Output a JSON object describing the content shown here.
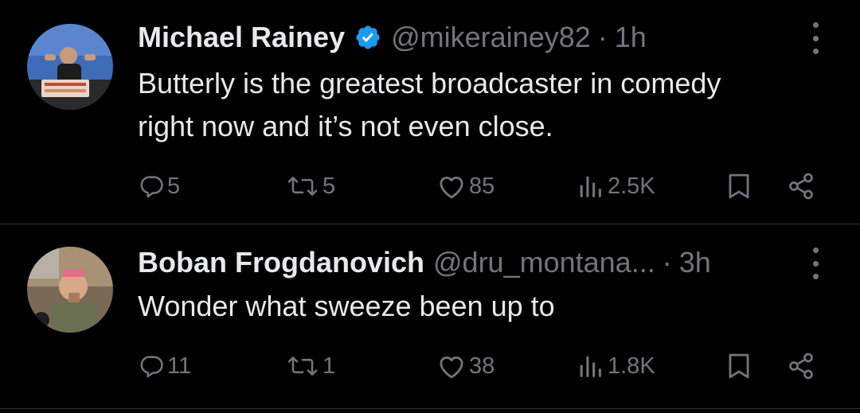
{
  "tweets": [
    {
      "name": "Michael Rainey",
      "verified": true,
      "handle": "@mikerainey82",
      "dot": "·",
      "time": "1h",
      "text_lines": [
        "Butterly is the greatest broadcaster in comedy",
        "right now and it’s not even close."
      ],
      "replies": "5",
      "reposts": "5",
      "likes": "85",
      "views": "2.5K",
      "avatar_icon": "avatar-photo"
    },
    {
      "name": "Boban Frogdanovich",
      "verified": false,
      "handle": "@dru_montana...",
      "dot": "·",
      "time": "3h",
      "text_lines": [
        "Wonder what sweeze been up to"
      ],
      "replies": "11",
      "reposts": "1",
      "likes": "38",
      "views": "1.8K",
      "avatar_icon": "avatar-photo"
    }
  ],
  "colors": {
    "background": "#000000",
    "text": "#e7e9ea",
    "secondary": "#71767b",
    "verified": "#1d9bf0",
    "divider": "#2f3336"
  },
  "icons": {
    "reply": "reply-icon",
    "repost": "repost-icon",
    "like": "like-icon",
    "views": "views-icon",
    "bookmark": "bookmark-icon",
    "share": "share-icon",
    "more": "more-icon",
    "verified": "verified-badge-icon"
  }
}
